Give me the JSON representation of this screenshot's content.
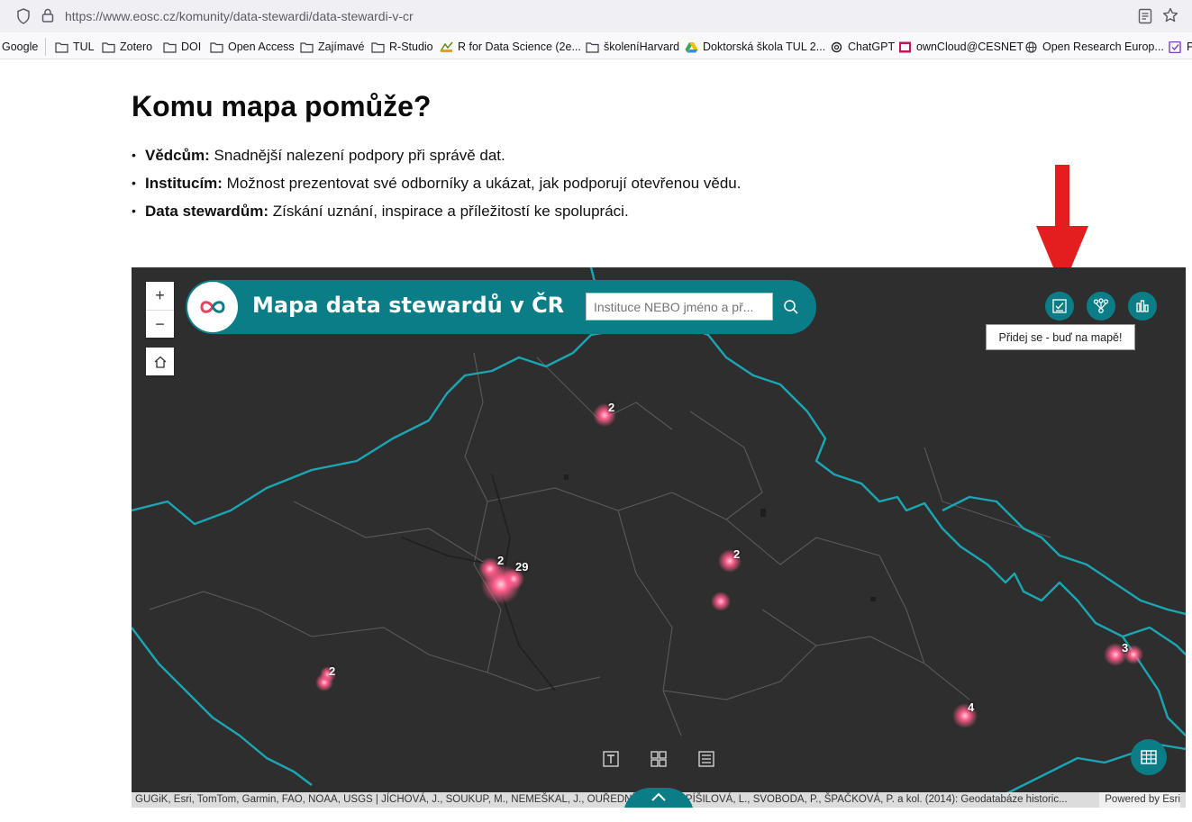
{
  "browser": {
    "url": "https://www.eosc.cz/komunity/data-stewardi/data-stewardi-v-cr",
    "bookmarks": [
      {
        "label": "Google",
        "icon": "none"
      },
      {
        "label": "TUL",
        "icon": "folder-icon"
      },
      {
        "label": "Zotero",
        "icon": "folder-icon"
      },
      {
        "label": "DOI",
        "icon": "folder-icon"
      },
      {
        "label": "Open Access",
        "icon": "folder-icon"
      },
      {
        "label": "Zajímavé",
        "icon": "folder-icon"
      },
      {
        "label": "R-Studio",
        "icon": "folder-icon"
      },
      {
        "label": "R for Data Science (2e...",
        "icon": "r4ds-icon"
      },
      {
        "label": "školeníHarvard",
        "icon": "folder-icon"
      },
      {
        "label": "Doktorská škola TUL 2...",
        "icon": "google-drive-icon"
      },
      {
        "label": "ChatGPT",
        "icon": "chatgpt-icon"
      },
      {
        "label": "ownCloud@CESNET",
        "icon": "owncloud-icon"
      },
      {
        "label": "Open Research Europ...",
        "icon": "globe-icon"
      },
      {
        "label": "P",
        "icon": "bookmark-icon"
      }
    ]
  },
  "page": {
    "heading": "Komu mapa pomůže?",
    "bullets": [
      {
        "bold": "Vědcům:",
        "text": " Snadnější nalezení podpory při správě dat."
      },
      {
        "bold": "Institucím:",
        "text": " Možnost prezentovat své odborníky a ukázat, jak podporují otevřenou vědu."
      },
      {
        "bold": "Data stewardům:",
        "text": " Získání uznání, inspirace a příležitostí ke spolupráci."
      }
    ]
  },
  "map": {
    "zoom_in": "+",
    "zoom_out": "−",
    "title": "Mapa data stewardů v ČR",
    "search_placeholder": "Instituce NEBO jméno a př...",
    "tooltip": "Přidej se - buď na mapě!",
    "clusters": [
      {
        "label": "2"
      },
      {
        "label": "2"
      },
      {
        "label": "29"
      },
      {
        "label": "2"
      },
      {
        "label": "2"
      },
      {
        "label": "3"
      },
      {
        "label": "4"
      }
    ],
    "attribution": "GUGiK, Esri, TomTom, Garmin, FAO, NOAA, USGS | JÍCHOVÁ, J., SOUKUP, M., NEMEŠKAL, J., OUŘEDNÍK, D., POSPÍŠILOVÁ, L., SVOBODA, P., ŠPAČKOVÁ, P. a kol. (2014): Geodatabáze historic...",
    "powered_by": "Powered by Esri",
    "colors": {
      "teal": "#0a7d87",
      "border": "#1aa6b3",
      "marker": "#ff5c8a"
    }
  }
}
